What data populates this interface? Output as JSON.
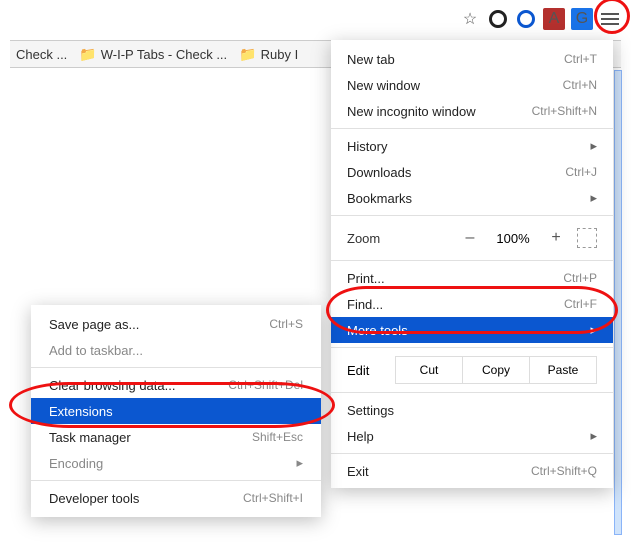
{
  "toolbar": {
    "star": "☆",
    "icons": [
      "ring",
      "circle",
      "acro",
      "gt",
      "hamburger"
    ],
    "acro_label": "A",
    "gt_label": "G"
  },
  "bookmarks": {
    "items": [
      {
        "label": "Check ..."
      },
      {
        "label": "W-I-P Tabs - Check ..."
      },
      {
        "label": "Ruby I"
      }
    ]
  },
  "menu": {
    "new_tab": "New tab",
    "new_tab_sc": "Ctrl+T",
    "new_window": "New window",
    "new_window_sc": "Ctrl+N",
    "new_incognito": "New incognito window",
    "new_incognito_sc": "Ctrl+Shift+N",
    "history": "History",
    "downloads": "Downloads",
    "downloads_sc": "Ctrl+J",
    "bookmarks": "Bookmarks",
    "zoom_label": "Zoom",
    "zoom_minus": "–",
    "zoom_val": "100%",
    "zoom_plus": "+",
    "print": "Print...",
    "print_sc": "Ctrl+P",
    "find": "Find...",
    "find_sc": "Ctrl+F",
    "more_tools": "More tools",
    "edit_label": "Edit",
    "cut": "Cut",
    "copy": "Copy",
    "paste": "Paste",
    "settings": "Settings",
    "help": "Help",
    "exit": "Exit",
    "exit_sc": "Ctrl+Shift+Q"
  },
  "submenu": {
    "save_page": "Save page as...",
    "save_page_sc": "Ctrl+S",
    "add_taskbar": "Add to taskbar...",
    "clear_browsing": "Clear browsing data...",
    "clear_browsing_sc": "Ctrl+Shift+Del",
    "extensions": "Extensions",
    "task_manager": "Task manager",
    "task_manager_sc": "Shift+Esc",
    "encoding": "Encoding",
    "dev_tools": "Developer tools",
    "dev_tools_sc": "Ctrl+Shift+I"
  }
}
